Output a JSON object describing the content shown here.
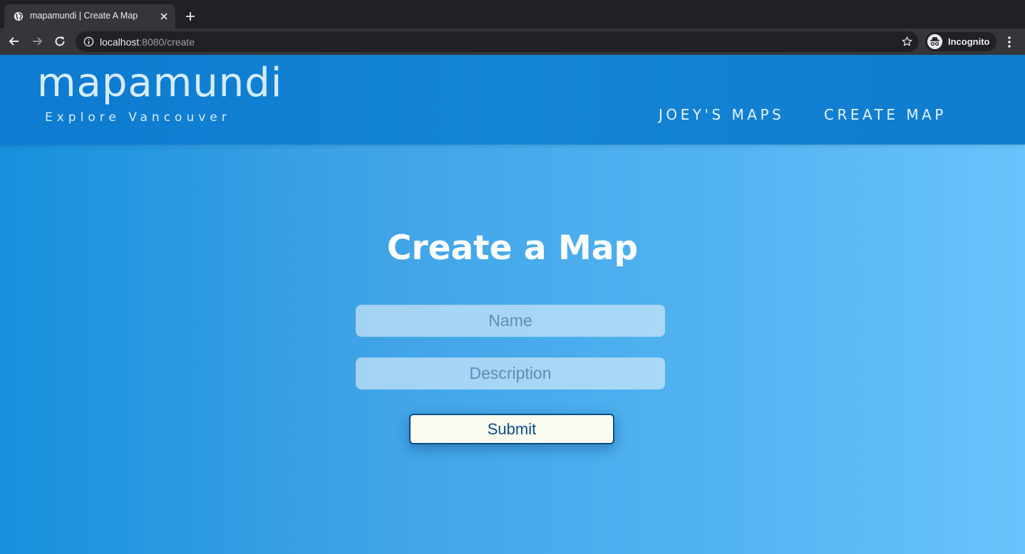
{
  "browser": {
    "tab_title": "mapamundi | Create A Map",
    "url_host": "localhost",
    "url_rest": ":8080/create",
    "profile_label": "Incognito"
  },
  "header": {
    "brand": "mapamundi",
    "tagline": "Explore Vancouver",
    "nav": [
      "JOEY'S MAPS",
      "CREATE MAP"
    ]
  },
  "form": {
    "heading": "Create a Map",
    "name_placeholder": "Name",
    "description_placeholder": "Description",
    "submit_label": "Submit"
  },
  "colors": {
    "header_bg": "#1482d4",
    "page_gradient_start": "#1790dd",
    "page_gradient_end": "#6ac3fb",
    "submit_bg": "#fafcf1",
    "submit_text": "#0a4d83"
  }
}
